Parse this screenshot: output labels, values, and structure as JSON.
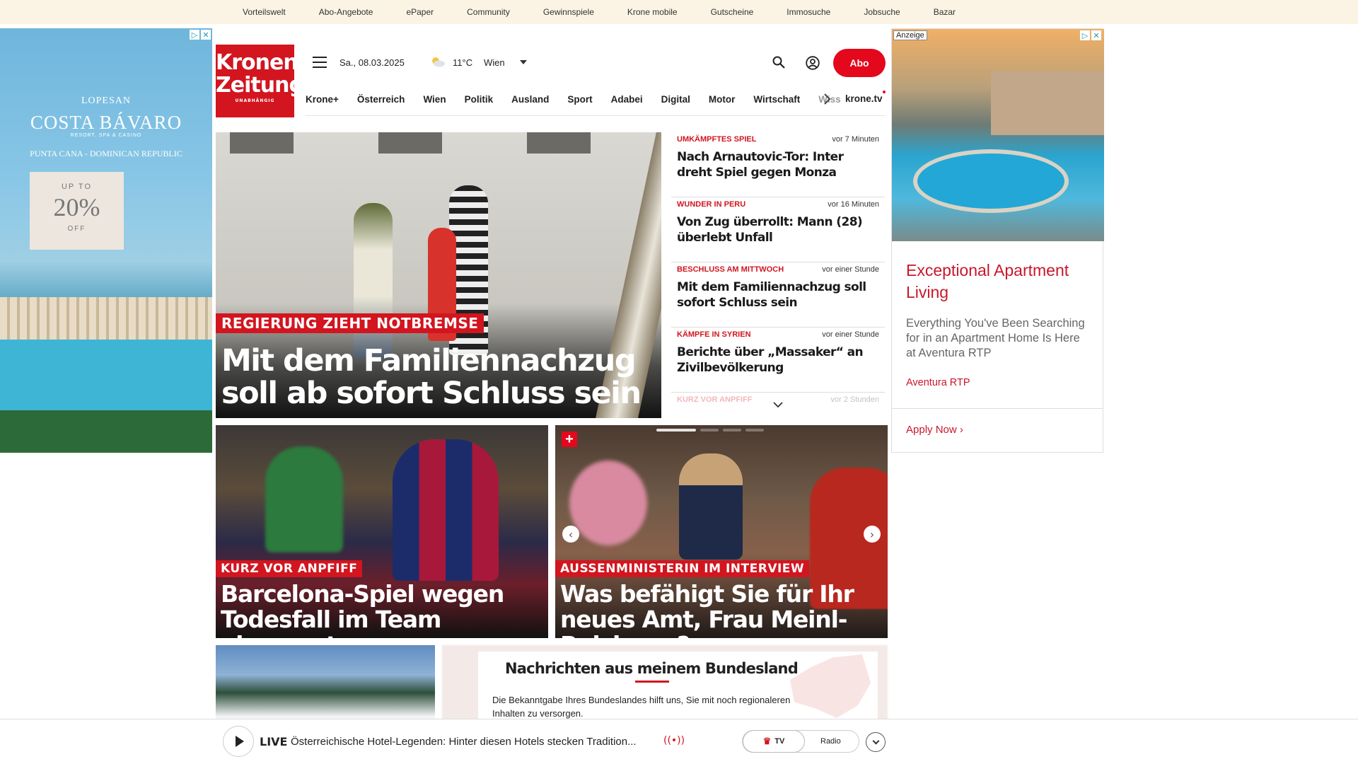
{
  "topbar": {
    "links": [
      "Vorteilswelt",
      "Abo-Angebote",
      "ePaper",
      "Community",
      "Gewinnspiele",
      "Krone mobile",
      "Gutscheine",
      "Immosuche",
      "Jobsuche",
      "Bazar"
    ]
  },
  "left_ad": {
    "brand_small": "LOPESAN",
    "brand_big": "COSTA BÁVARO",
    "brand_sub": "RESORT, SPA & CASINO",
    "location": "PUNTA CANA - DOMINICAN REPUBLIC",
    "promo_top": "UP TO",
    "promo_value": "20%",
    "promo_bottom": "OFF"
  },
  "header": {
    "logo_line1": "Kronen",
    "logo_line2": "Zeitung",
    "logo_tagline": "UNABHÄNGIG",
    "date": "Sa., 08.03.2025",
    "temperature": "11°C",
    "city": "Wien",
    "abo_label": "Abo",
    "nav": [
      "Krone+",
      "Österreich",
      "Wien",
      "Politik",
      "Ausland",
      "Sport",
      "Adabei",
      "Digital",
      "Motor",
      "Wirtschaft",
      "Wiss"
    ],
    "nav_extra": "krone.tv"
  },
  "hero": {
    "kicker": "REGIERUNG ZIEHT NOTBREMSE",
    "headline": "Mit dem Familiennachzug soll ab sofort Schluss sein"
  },
  "news": [
    {
      "kicker": "UMKÄMPFTES SPIEL",
      "time": "vor 7 Minuten",
      "headline": "Nach Arnautovic-Tor: Inter dreht Spiel gegen Monza"
    },
    {
      "kicker": "WUNDER IN PERU",
      "time": "vor 16 Minuten",
      "headline": "Von Zug überrollt: Mann (28) überlebt Unfall"
    },
    {
      "kicker": "BESCHLUSS AM MITTWOCH",
      "time": "vor einer Stunde",
      "headline": "Mit dem Familiennachzug soll sofort Schluss sein"
    },
    {
      "kicker": "KÄMPFE IN SYRIEN",
      "time": "vor einer Stunde",
      "headline": "Berichte über „Massaker“ an Zivilbevölkerung"
    },
    {
      "kicker": "KURZ VOR ANPFIFF",
      "time": "vor 2 Stunden",
      "headline": ""
    }
  ],
  "cards": [
    {
      "kicker": "KURZ VOR ANPFIFF",
      "headline": "Barcelona-Spiel wegen Todesfall im Team abgesagt"
    },
    {
      "kicker": "AUSSENMINISTERIN IM INTERVIEW",
      "headline": "Was befähigt Sie für Ihr neues Amt, Frau Meinl-Reisinger?",
      "plus": "+"
    }
  ],
  "bundesland": {
    "title": "Nachrichten aus meinem Bundesland",
    "text": "Die Bekanntgabe Ihres Bundeslandes hilft uns, Sie mit noch regionaleren Inhalten zu versorgen."
  },
  "live": {
    "label": "LIVE",
    "title": "Österreichische Hotel-Legenden: Hinter diesen Hotels stecken Tradition...",
    "wave": "((•))",
    "tv_label": "TV",
    "radio_label": "Radio"
  },
  "right_ad": {
    "anzeige": "Anzeige",
    "title": "Exceptional Apartment Living",
    "description": "Everything You've Been Searching for in an Apartment Home Is Here at Aventura RTP",
    "advertiser": "Aventura RTP",
    "cta": "Apply Now"
  },
  "colors": {
    "brand_red": "#d2151f",
    "topbar_bg": "#fbf4e4",
    "ad_red": "#c8172b"
  }
}
